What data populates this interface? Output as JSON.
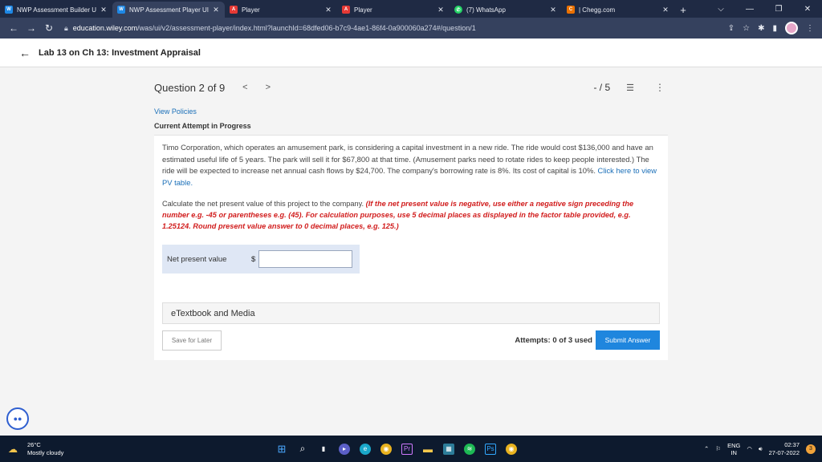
{
  "browser": {
    "tabs": [
      {
        "label": "NWP Assessment Builder U",
        "favicon": "W",
        "favicon_color": "#1e88e5"
      },
      {
        "label": "NWP Assessment Player UI",
        "favicon": "W",
        "favicon_color": "#1e88e5"
      },
      {
        "label": "Player",
        "favicon": "A",
        "favicon_color": "#e53935"
      },
      {
        "label": "Player",
        "favicon": "A",
        "favicon_color": "#e53935"
      },
      {
        "label": "(7) WhatsApp",
        "favicon": "✆",
        "favicon_color": "#25d366"
      },
      {
        "label": "| Chegg.com",
        "favicon": "C",
        "favicon_color": "#eb7100"
      }
    ],
    "new_tab": "+",
    "url_host": "education.wiley.com",
    "url_path": "/was/ui/v2/assessment-player/index.html?launchId=68dfed06-b7c9-4ae1-86f4-0a900060a274#/question/1"
  },
  "header": {
    "title": "Lab 13 on Ch 13: Investment Appraisal"
  },
  "question": {
    "label": "Question 2 of 9",
    "score": "- / 5",
    "view_policies": "View Policies",
    "attempt_status": "Current Attempt in Progress",
    "problem_text": "Timo Corporation, which operates an amusement park, is considering a capital investment in a new ride. The ride would cost $136,000 and have an estimated useful life of 5 years. The park will sell it for $67,800 at that time. (Amusement parks need to rotate rides to keep people interested.) The ride will be expected to increase net annual cash flows by $24,700. The company's borrowing rate is 8%. Its cost of capital is 10%.",
    "pv_link": "Click here to view PV table.",
    "instruction_plain": "Calculate the net present value of this project to the company.",
    "instruction_red": "(If the net present value is negative, use either a negative sign preceding the number e.g. -45 or parentheses e.g. (45). For calculation purposes, use 5 decimal places as displayed in the factor table provided, e.g. 1.25124. Round present value answer to 0 decimal places, e.g. 125.)",
    "field_label": "Net present value",
    "currency": "$",
    "field_value": "",
    "etextbook": "eTextbook and Media",
    "save_label": "Save for Later",
    "attempts": "Attempts: 0 of 3 used",
    "submit_label": "Submit Answer"
  },
  "taskbar": {
    "temp": "26°C",
    "weather": "Mostly cloudy",
    "lang_line1": "ENG",
    "lang_line2": "IN",
    "time": "02:37",
    "date": "27-07-2022",
    "notifications": "3"
  }
}
